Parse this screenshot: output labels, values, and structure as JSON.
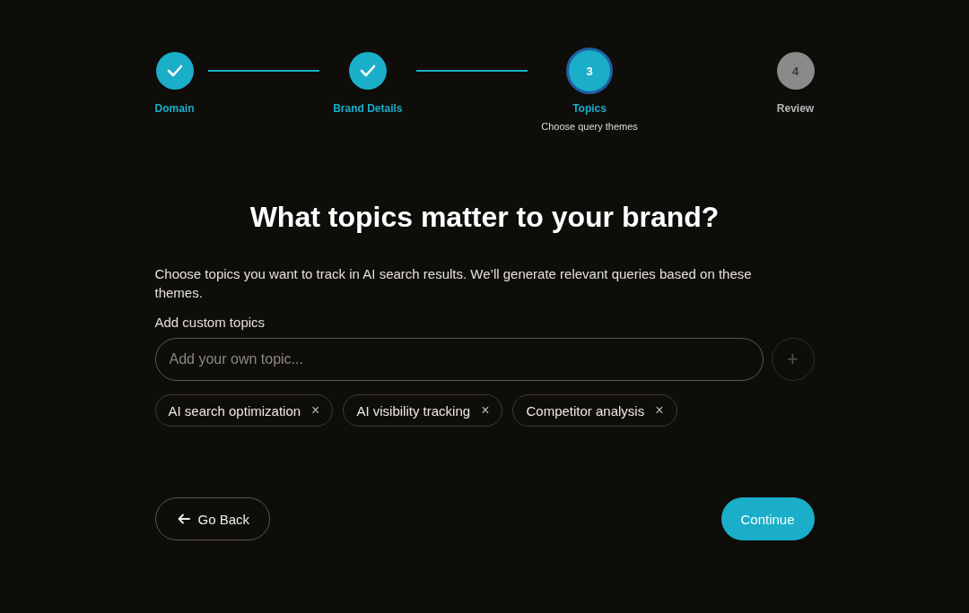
{
  "steps": [
    {
      "label": "Domain",
      "kind": "done"
    },
    {
      "label": "Brand Details",
      "kind": "done"
    },
    {
      "number": "3",
      "label": "Topics",
      "subtitle": "Choose query themes",
      "kind": "current"
    },
    {
      "number": "4",
      "label": "Review",
      "kind": "upcoming"
    }
  ],
  "title": "What topics matter to your brand?",
  "description": "Choose topics you want to track in AI search results. We’ll generate relevant queries based on these themes.",
  "custom_topics": {
    "label": "Add custom topics",
    "placeholder": "Add your own topic...",
    "add_button": "+"
  },
  "topics": [
    {
      "label": "AI search optimization",
      "remove": "×"
    },
    {
      "label": "AI visibility tracking",
      "remove": "×"
    },
    {
      "label": "Competitor analysis",
      "remove": "×"
    }
  ],
  "back_button": {
    "label": "Go Back"
  },
  "continue_button": {
    "label": "Continue"
  }
}
